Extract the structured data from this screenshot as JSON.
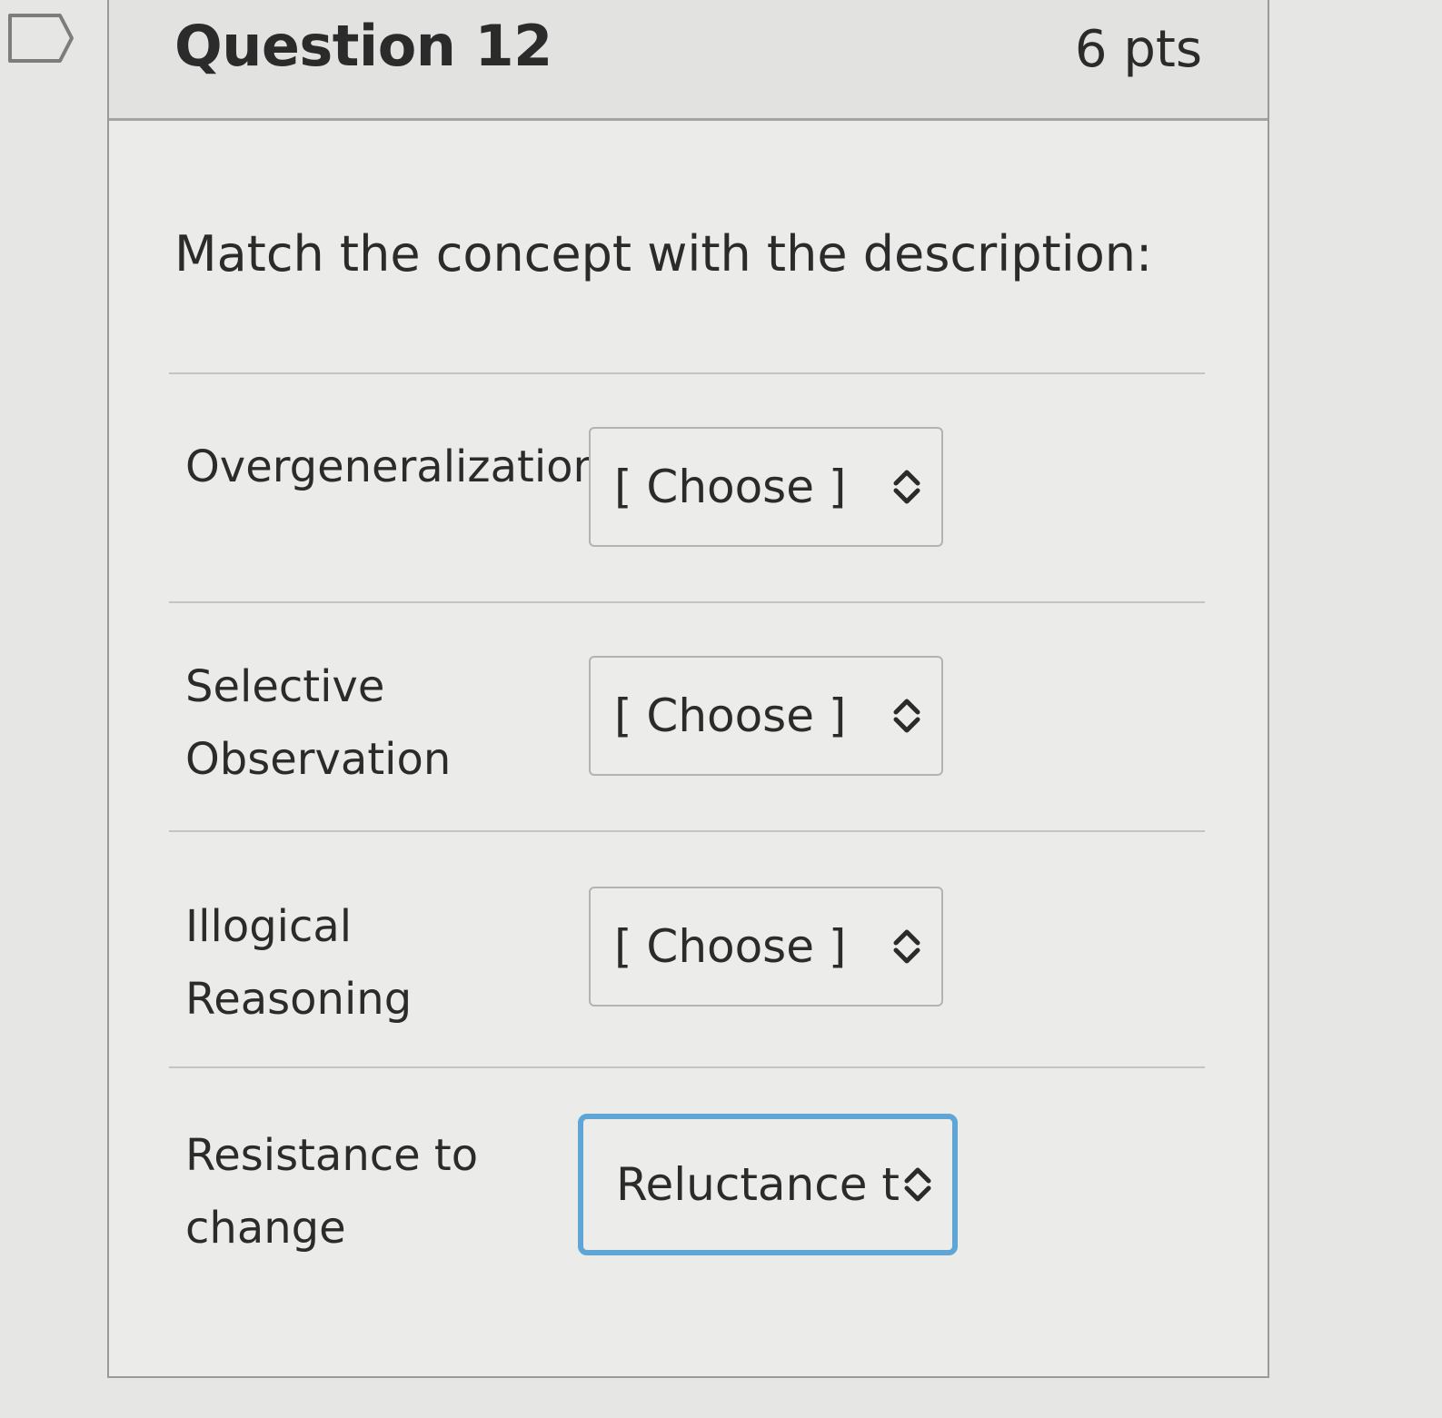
{
  "question": {
    "title": "Question 12",
    "points": "6 pts",
    "prompt": "Match the concept with the description:"
  },
  "matches": [
    {
      "concept_line1": "Overgeneralization",
      "concept_line2": "",
      "selected": "[ Choose ]"
    },
    {
      "concept_line1": "Selective",
      "concept_line2": "Observation",
      "selected": "[ Choose ]"
    },
    {
      "concept_line1": "Illogical Reasoning",
      "concept_line2": "",
      "selected": "[ Choose ]"
    },
    {
      "concept_line1": "Resistance to",
      "concept_line2": "change",
      "selected": "Reluctance t",
      "focused": true
    }
  ],
  "colors": {
    "focus_border": "#5fa5d6",
    "text": "#2b2b2b"
  }
}
